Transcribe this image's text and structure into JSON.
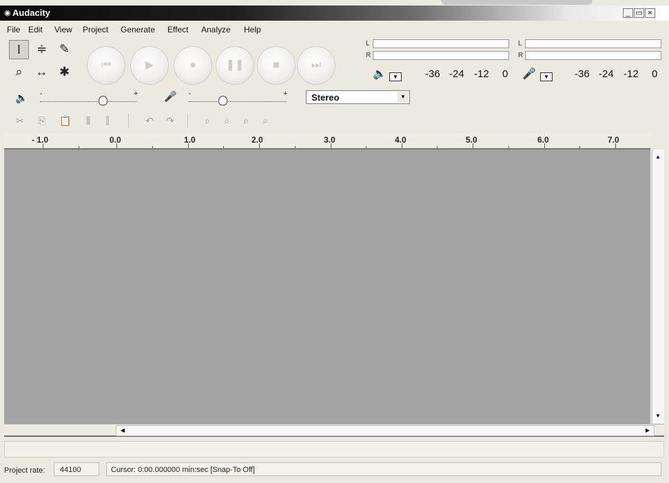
{
  "window": {
    "title": "Audacity",
    "minimize": "_",
    "maximize": "▭",
    "close": "×"
  },
  "menu": [
    "File",
    "Edit",
    "View",
    "Project",
    "Generate",
    "Effect",
    "Analyze",
    "Help"
  ],
  "tools": {
    "selection": "I",
    "envelope": "≑",
    "draw": "✎",
    "zoom": "⌕",
    "timeshift": "↔",
    "multi": "✱"
  },
  "transport": {
    "skip_start": "⏮",
    "play": "▶",
    "record": "●",
    "pause": "❚❚",
    "stop": "■",
    "skip_end": "⏭"
  },
  "meters": {
    "left_label": "L",
    "right_label": "R",
    "ticks": [
      "-36",
      "-24",
      "-12",
      "0"
    ]
  },
  "mixer": {
    "minus": "-",
    "plus": "+",
    "input_source": "Stereo"
  },
  "ruler": [
    "- 1.0",
    "0.0",
    "1.0",
    "2.0",
    "3.0",
    "4.0",
    "5.0",
    "6.0",
    "7.0"
  ],
  "status": {
    "project_rate_label": "Project rate:",
    "project_rate": "44100",
    "cursor": "Cursor: 0:00.000000 min:sec  [Snap-To Off]"
  },
  "colors": {
    "track_bg": "#a4a4a4",
    "window_bg": "#ece9e0",
    "title_bg": "#0a0a0a"
  }
}
